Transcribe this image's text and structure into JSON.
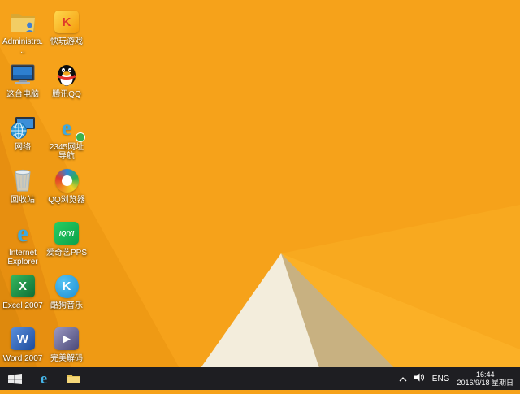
{
  "wallpaper": {
    "base": "#f6a21a",
    "ray_facet": "#f8a91f",
    "right_facet": "#fbb026",
    "mid_left_facet": "#ef9a14",
    "dark_left_facet": "#e78f10",
    "corner_facet": "#de890d",
    "white_facet": "#f3eddc",
    "tan_facet": "#c8b181"
  },
  "desktop_icons": [
    {
      "name": "administrator-files",
      "label": "Administra..."
    },
    {
      "name": "this-pc",
      "label": "这台电脑"
    },
    {
      "name": "network",
      "label": "网络"
    },
    {
      "name": "recycle-bin",
      "label": "回收站"
    },
    {
      "name": "internet-explorer",
      "label": "Internet Explorer",
      "glyph": "e"
    },
    {
      "name": "excel-2007",
      "label": "Excel 2007",
      "glyph": "X"
    },
    {
      "name": "word-2007",
      "label": "Word 2007",
      "glyph": "W"
    },
    {
      "name": "kuaiwan-games",
      "label": "快玩游戏",
      "glyph": "K"
    },
    {
      "name": "tencent-qq",
      "label": "腾讯QQ"
    },
    {
      "name": "2345-web-navigation",
      "label": "2345网址导航",
      "glyph": "e"
    },
    {
      "name": "qq-browser",
      "label": "QQ浏览器"
    },
    {
      "name": "iqiyi-pps",
      "label": "爱奇艺PPS",
      "glyph": "iQIYI"
    },
    {
      "name": "kugou-music",
      "label": "酷狗音乐",
      "glyph": "K"
    },
    {
      "name": "perfect-decoder",
      "label": "完美解码",
      "glyph": "▶"
    }
  ],
  "taskbar": {
    "background": "#1e1e22",
    "pinned": [
      {
        "name": "internet-explorer",
        "glyph": "e"
      },
      {
        "name": "file-explorer"
      }
    ],
    "tray": {
      "language": "ENG",
      "time": "16:44",
      "date": "2016/9/18 星期日"
    }
  }
}
